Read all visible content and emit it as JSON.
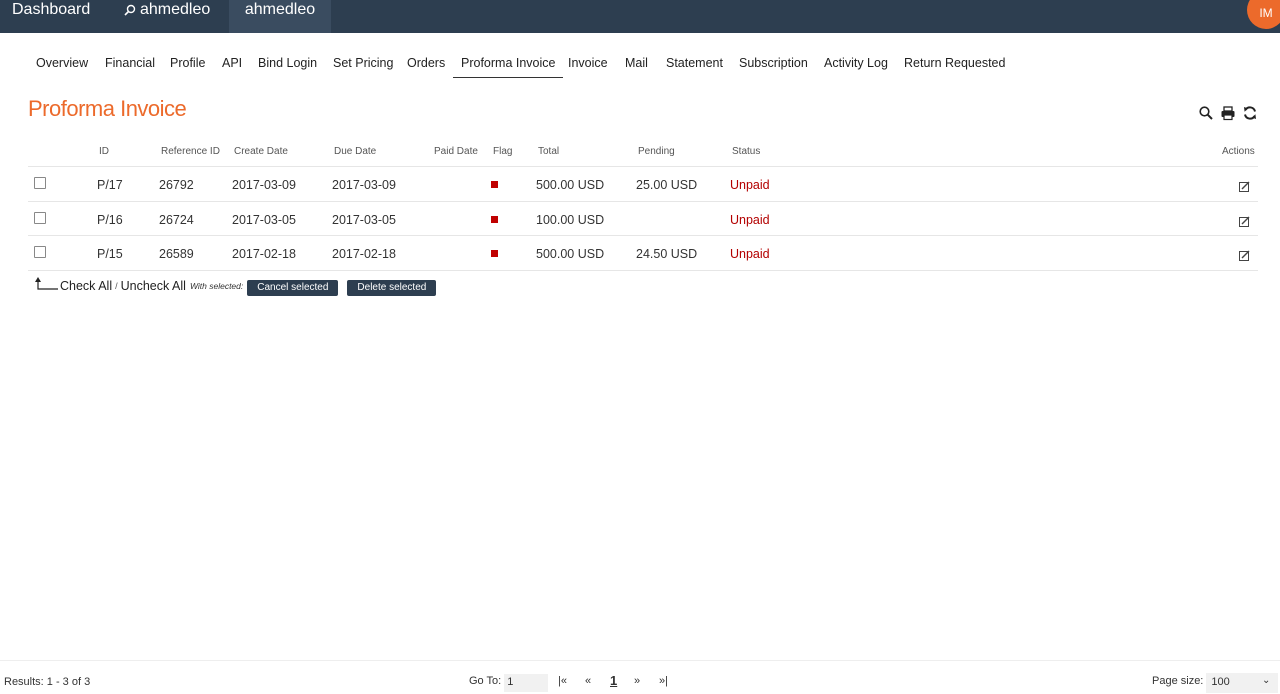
{
  "topbar": {
    "dashboard": "Dashboard",
    "search_user": "ahmedleo",
    "active_user": "ahmedleo",
    "avatar_initials": "IM"
  },
  "tabs": [
    "Overview",
    "Financial",
    "Profile",
    "API",
    "Bind Login",
    "Set Pricing",
    "Orders",
    "Proforma Invoice",
    "Invoice",
    "Mail",
    "Statement",
    "Subscription",
    "Activity Log",
    "Return Requested"
  ],
  "active_tab": "Proforma Invoice",
  "page_title": "Proforma Invoice",
  "table": {
    "headers": {
      "id": "ID",
      "reference": "Reference ID",
      "create_date": "Create Date",
      "due_date": "Due Date",
      "paid_date": "Paid Date",
      "flag": "Flag",
      "total": "Total",
      "pending": "Pending",
      "status": "Status",
      "actions": "Actions"
    },
    "rows": [
      {
        "id": "P/17",
        "reference": "26792",
        "create_date": "2017-03-09",
        "due_date": "2017-03-09",
        "paid_date": "",
        "total": "500.00 USD",
        "pending": "25.00 USD",
        "status": "Unpaid"
      },
      {
        "id": "P/16",
        "reference": "26724",
        "create_date": "2017-03-05",
        "due_date": "2017-03-05",
        "paid_date": "",
        "total": "100.00 USD",
        "pending": "",
        "status": "Unpaid"
      },
      {
        "id": "P/15",
        "reference": "26589",
        "create_date": "2017-02-18",
        "due_date": "2017-02-18",
        "paid_date": "",
        "total": "500.00 USD",
        "pending": "24.50 USD",
        "status": "Unpaid"
      }
    ]
  },
  "bulk": {
    "check_all": "Check All",
    "separator": "/",
    "uncheck_all": "Uncheck All",
    "with_selected": "With selected:",
    "cancel_selected": "Cancel selected",
    "delete_selected": "Delete selected"
  },
  "footer": {
    "results": "Results: 1 - 3 of 3",
    "goto_label": "Go To:",
    "goto_value": "1",
    "first": "|«",
    "prev": "«",
    "current_page": "1",
    "next": "»",
    "last": "»|",
    "page_size_label": "Page size:",
    "page_size_value": "100"
  },
  "colors": {
    "topbar": "#2d3e50",
    "accent": "#ec6a2b",
    "unpaid": "#b30000",
    "flag": "#c00000"
  }
}
